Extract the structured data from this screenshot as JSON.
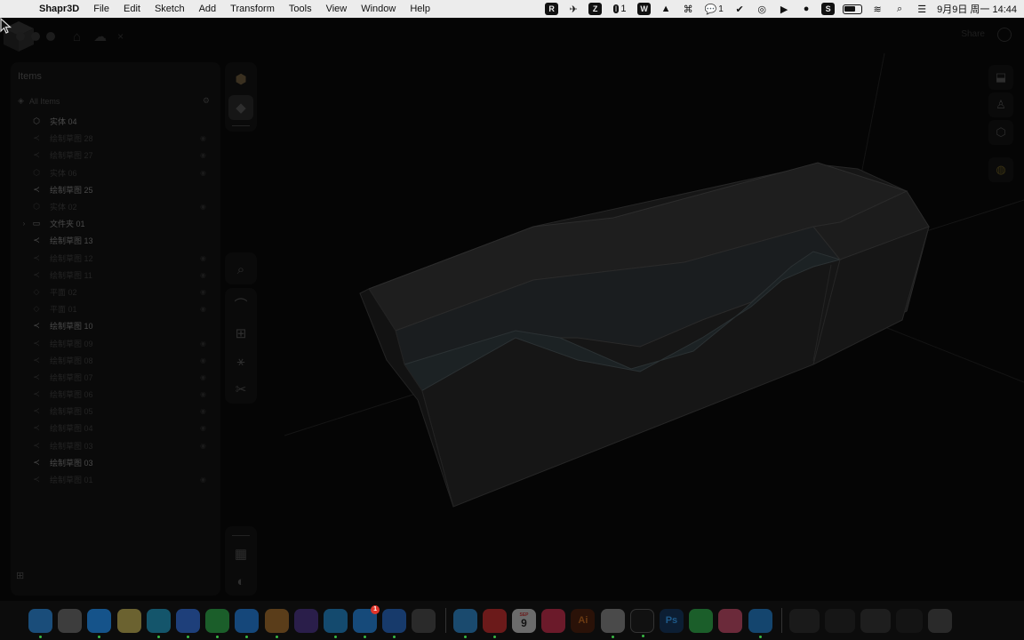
{
  "menubar": {
    "app_name": "Shapr3D",
    "menus": [
      "File",
      "Edit",
      "Sketch",
      "Add",
      "Transform",
      "Tools",
      "View",
      "Window",
      "Help"
    ],
    "wechat_badge": "1",
    "extra_badge": "1",
    "datetime": "9月9日 周一  14:44"
  },
  "titlebar": {
    "share_label": "Share"
  },
  "items_panel": {
    "title": "Items",
    "all_items_label": "All Items",
    "items": [
      {
        "label": "实体 04",
        "icon": "solid-icon",
        "visible": true,
        "expandable": false
      },
      {
        "label": "绘制草图 28",
        "icon": "sketch-icon",
        "visible": false,
        "expandable": false
      },
      {
        "label": "绘制草图 27",
        "icon": "sketch-icon",
        "visible": false,
        "expandable": false
      },
      {
        "label": "实体 06",
        "icon": "solid-icon",
        "visible": false,
        "expandable": false
      },
      {
        "label": "绘制草图 25",
        "icon": "sketch-icon",
        "visible": true,
        "expandable": false
      },
      {
        "label": "实体 02",
        "icon": "solid-icon",
        "visible": false,
        "expandable": false
      },
      {
        "label": "文件夹 01",
        "icon": "folder-icon",
        "visible": true,
        "expandable": true
      },
      {
        "label": "绘制草图 13",
        "icon": "sketch-icon",
        "visible": true,
        "expandable": false
      },
      {
        "label": "绘制草图 12",
        "icon": "sketch-icon",
        "visible": false,
        "expandable": false
      },
      {
        "label": "绘制草图 11",
        "icon": "sketch-icon",
        "visible": false,
        "expandable": false
      },
      {
        "label": "平面 02",
        "icon": "plane-icon",
        "visible": false,
        "expandable": false
      },
      {
        "label": "平面 01",
        "icon": "plane-icon",
        "visible": false,
        "expandable": false
      },
      {
        "label": "绘制草图 10",
        "icon": "sketch-icon",
        "visible": true,
        "expandable": false
      },
      {
        "label": "绘制草图 09",
        "icon": "sketch-icon",
        "visible": false,
        "expandable": false
      },
      {
        "label": "绘制草图 08",
        "icon": "sketch-icon",
        "visible": false,
        "expandable": false
      },
      {
        "label": "绘制草图 07",
        "icon": "sketch-icon",
        "visible": false,
        "expandable": false
      },
      {
        "label": "绘制草图 06",
        "icon": "sketch-icon",
        "visible": false,
        "expandable": false
      },
      {
        "label": "绘制草图 05",
        "icon": "sketch-icon",
        "visible": false,
        "expandable": false
      },
      {
        "label": "绘制草图 04",
        "icon": "sketch-icon",
        "visible": false,
        "expandable": false
      },
      {
        "label": "绘制草图 03",
        "icon": "sketch-icon",
        "visible": false,
        "expandable": false
      },
      {
        "label": "绘制草图 03",
        "icon": "sketch-icon",
        "visible": true,
        "expandable": false
      },
      {
        "label": "绘制草图 01",
        "icon": "sketch-icon",
        "visible": false,
        "expandable": false
      }
    ]
  },
  "dock": {
    "calendar_month": "SEP",
    "calendar_day": "9",
    "mail_badge": "1"
  }
}
